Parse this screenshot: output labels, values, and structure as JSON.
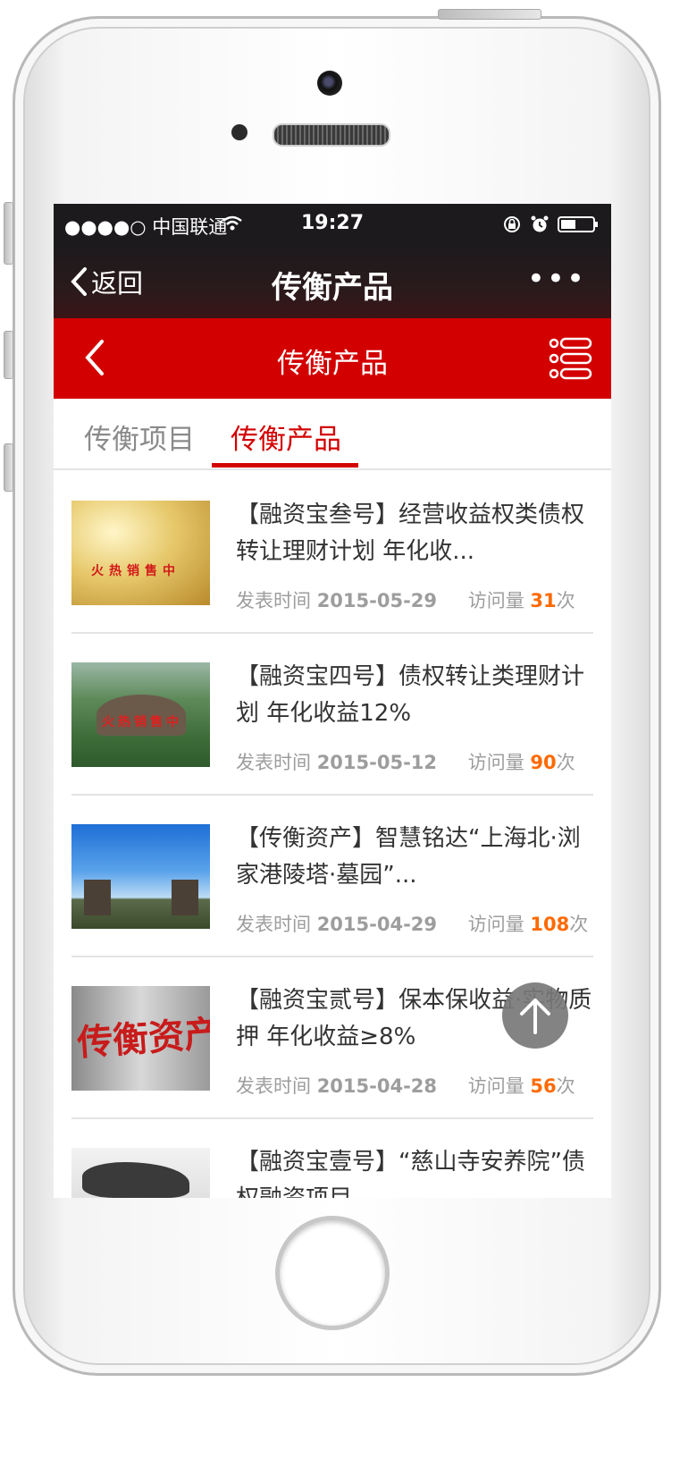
{
  "status_bar": {
    "carrier": "●●●●○ 中国联通",
    "time": "19:27"
  },
  "wechat_nav": {
    "back_label": "返回",
    "title": "传衡产品",
    "more_label": "•••"
  },
  "site_header": {
    "title": "传衡产品"
  },
  "tabs": [
    {
      "label": "传衡项目",
      "active": false
    },
    {
      "label": "传衡产品",
      "active": true
    }
  ],
  "list": {
    "date_label": "发表时间",
    "views_label": "访问量",
    "views_unit": "次",
    "items": [
      {
        "title": "【融资宝叁号】经营收益权类债权转让理财计划 年化收...",
        "date": "2015-05-29",
        "views": "31",
        "thumb_text": "火热销售中"
      },
      {
        "title": "【融资宝四号】债权转让类理财计划 年化收益12%",
        "date": "2015-05-12",
        "views": "90",
        "thumb_text": "火热销售中"
      },
      {
        "title": "【传衡资产】智慧铭达“上海北·浏家港陵塔·墓园”...",
        "date": "2015-04-29",
        "views": "108",
        "thumb_text": ""
      },
      {
        "title": "【融资宝贰号】保本保收益·实物质押 年化收益≥8%",
        "date": "2015-04-28",
        "views": "56",
        "thumb_text": "传衡资产"
      },
      {
        "title": "【融资宝壹号】“慈山寺安养院”债权融资项目",
        "date": "",
        "views": "",
        "thumb_text": ""
      }
    ]
  },
  "colors": {
    "brand_red": "#d30000",
    "count_orange": "#ff6a00",
    "nav_dark": "#1c1a1d"
  }
}
